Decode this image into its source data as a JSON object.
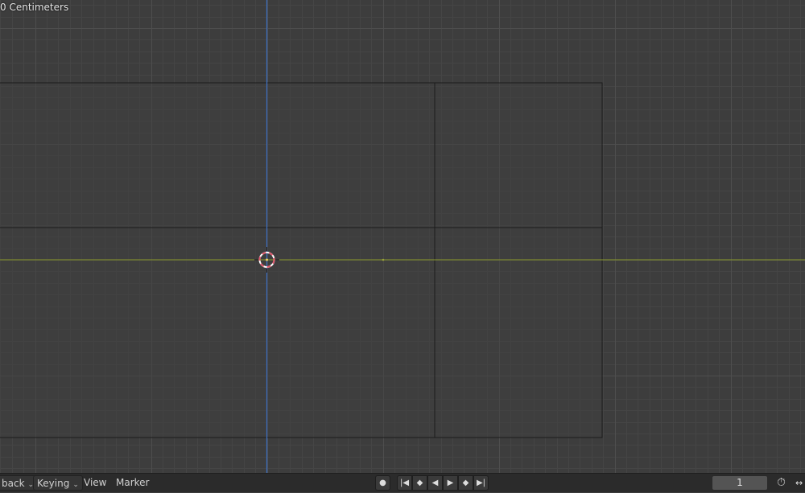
{
  "viewport": {
    "units_label": "0 Centimeters",
    "colors": {
      "background": "#3d3d3d",
      "grid_minor": "#454545",
      "grid_major": "#4e4e4e",
      "camera_frame": "#1c1c1c",
      "x_axis": "#8c9a2a",
      "z_axis": "#3c6fc0",
      "cursor_red": "#e0556b",
      "cursor_white": "#ffffff"
    }
  },
  "timeline": {
    "menus": [
      {
        "label": "back",
        "dropdown": true
      },
      {
        "label": "Keying",
        "dropdown": true
      },
      {
        "label": "View",
        "dropdown": false
      },
      {
        "label": "Marker",
        "dropdown": false
      }
    ],
    "transport_icons": [
      "record-icon",
      "jump-start-icon",
      "prev-keyframe-icon",
      "play-reverse-icon",
      "play-icon",
      "next-keyframe-icon",
      "jump-end-icon"
    ],
    "current_frame": "1",
    "stopwatch_icon": "stopwatch-icon"
  }
}
